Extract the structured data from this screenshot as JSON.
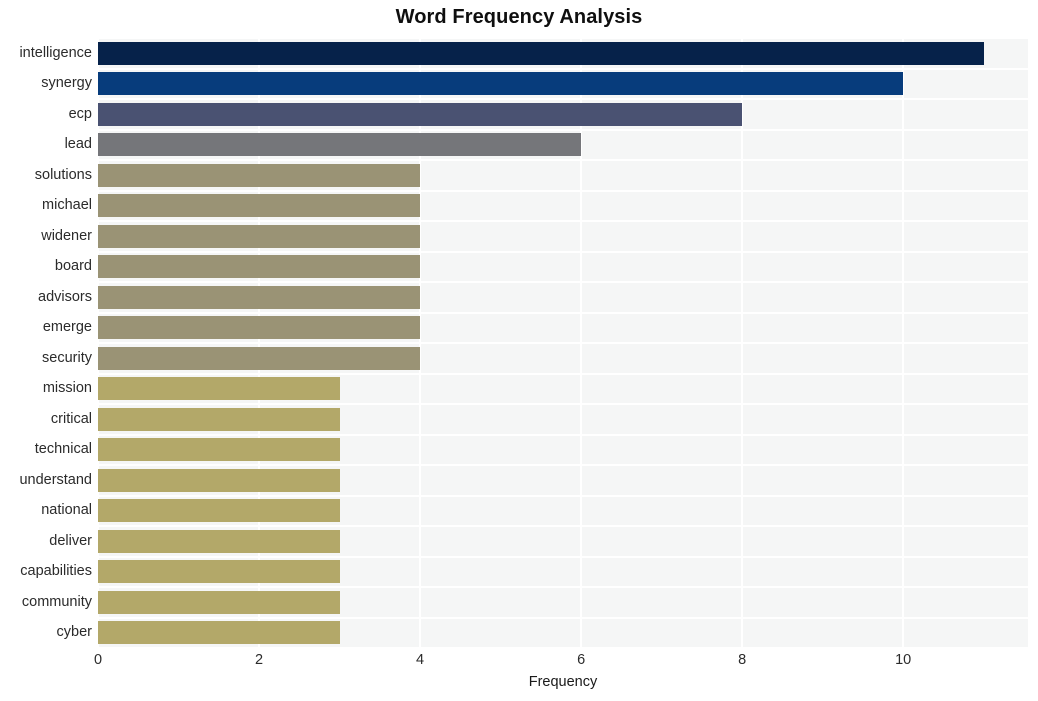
{
  "chart_data": {
    "type": "bar",
    "orientation": "horizontal",
    "title": "Word Frequency Analysis",
    "xlabel": "Frequency",
    "ylabel": "",
    "xlim": [
      0,
      11.55
    ],
    "ylim_categories": 20,
    "grid": true,
    "legend": null,
    "xticks": [
      0,
      2,
      4,
      6,
      8,
      10
    ],
    "xtick_labels": [
      "0",
      "2",
      "4",
      "6",
      "8",
      "10"
    ],
    "categories": [
      "intelligence",
      "synergy",
      "ecp",
      "lead",
      "solutions",
      "michael",
      "widener",
      "board",
      "advisors",
      "emerge",
      "security",
      "mission",
      "critical",
      "technical",
      "understand",
      "national",
      "deliver",
      "capabilities",
      "community",
      "cyber"
    ],
    "values": [
      11,
      10,
      8,
      6,
      4,
      4,
      4,
      4,
      4,
      4,
      4,
      3,
      3,
      3,
      3,
      3,
      3,
      3,
      3,
      3
    ],
    "bar_colors": [
      "#06224a",
      "#073c7c",
      "#4a5272",
      "#75767a",
      "#9a9375",
      "#9a9375",
      "#9a9375",
      "#9a9375",
      "#9a9375",
      "#9a9375",
      "#9a9375",
      "#b3a869",
      "#b3a869",
      "#b3a869",
      "#b3a869",
      "#b3a869",
      "#b3a869",
      "#b3a869",
      "#b3a869",
      "#b3a869"
    ],
    "plot_background": "#f5f6f6",
    "grid_color": "#ffffff",
    "figure_background": "#ffffff"
  }
}
